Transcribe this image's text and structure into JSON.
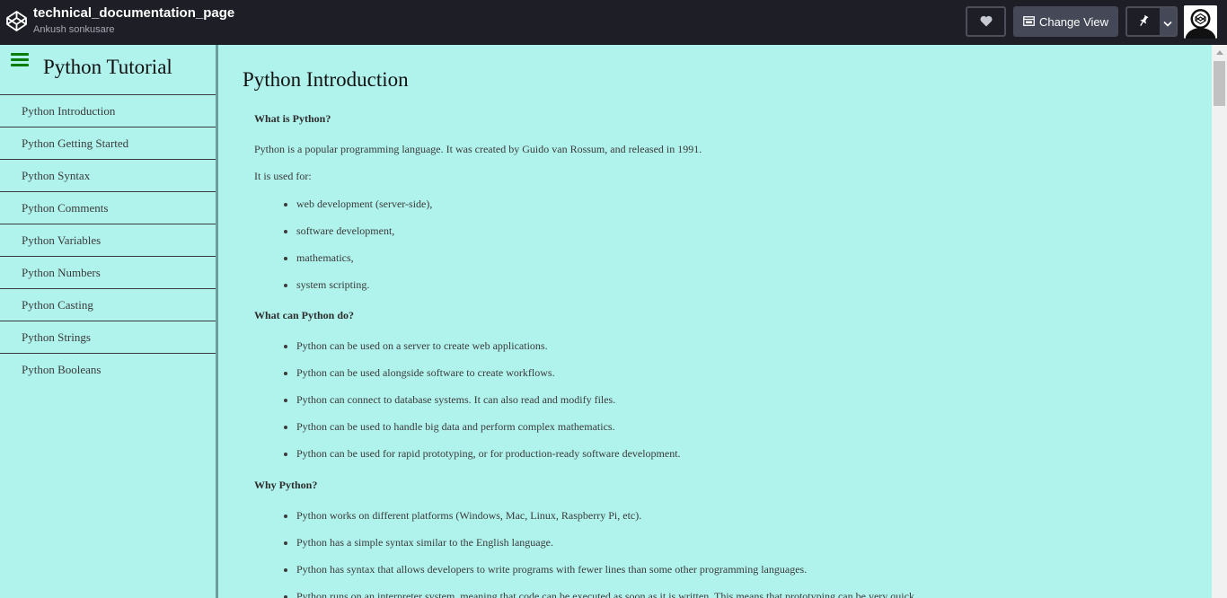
{
  "header": {
    "title": "technical_documentation_page",
    "author": "Ankush sonkusare",
    "change_view_label": "Change View"
  },
  "icons": {
    "logo": "codepen-logo-icon",
    "heart": "heart-icon",
    "change_view": "layout-icon",
    "pin": "pin-icon",
    "dropdown": "chevron-down-icon",
    "menu": "hamburger-menu-icon",
    "avatar": "user-avatar"
  },
  "colors": {
    "topbar_bg": "#1e1f26",
    "content_bg": "#b0f2ec",
    "hamburger": "#0a7d0a",
    "button_bg": "#444857"
  },
  "sidebar": {
    "title": "Python Tutorial",
    "items": [
      {
        "label": "Python Introduction"
      },
      {
        "label": "Python Getting Started"
      },
      {
        "label": "Python Syntax"
      },
      {
        "label": "Python Comments"
      },
      {
        "label": "Python Variables"
      },
      {
        "label": "Python Numbers"
      },
      {
        "label": "Python Casting"
      },
      {
        "label": "Python Strings"
      },
      {
        "label": "Python Booleans"
      }
    ]
  },
  "main": {
    "title": "Python Introduction",
    "sections": [
      {
        "heading": "What is Python?",
        "paragraphs": [
          "Python is a popular programming language. It was created by Guido van Rossum, and released in 1991.",
          "It is used for:"
        ],
        "bullets": [
          "web development (server-side),",
          "software development,",
          "mathematics,",
          "system scripting."
        ]
      },
      {
        "heading": "What can Python do?",
        "bullets": [
          "Python can be used on a server to create web applications.",
          "Python can be used alongside software to create workflows.",
          "Python can connect to database systems. It can also read and modify files.",
          "Python can be used to handle big data and perform complex mathematics.",
          "Python can be used for rapid prototyping, or for production-ready software development."
        ]
      },
      {
        "heading": "Why Python?",
        "bullets": [
          "Python works on different platforms (Windows, Mac, Linux, Raspberry Pi, etc).",
          "Python has a simple syntax similar to the English language.",
          "Python has syntax that allows developers to write programs with fewer lines than some other programming languages.",
          "Python runs on an interpreter system, meaning that code can be executed as soon as it is written. This means that prototyping can be very quick."
        ]
      }
    ]
  }
}
